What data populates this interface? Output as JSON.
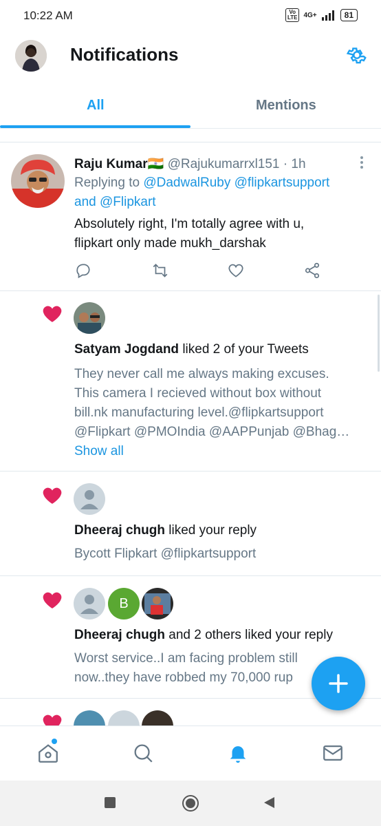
{
  "status_bar": {
    "time": "10:22 AM",
    "network": "4G+",
    "volte": "Vo LTE",
    "battery": "81"
  },
  "header": {
    "title": "Notifications"
  },
  "tabs": [
    {
      "label": "All"
    },
    {
      "label": "Mentions"
    }
  ],
  "reply_tweet": {
    "name": "Raju Kumar",
    "flag": "🇮🇳",
    "handle": "@Rajukumarrxl151",
    "time": "· 1h",
    "replying_prefix": "Replying to",
    "replying_1": "@DadwalRuby",
    "replying_2": "@flipkartsupport",
    "replying_and": "and",
    "replying_3": "@Flipkart",
    "text_1": "Absolutely right, I'm totally agree with u,",
    "text_2": "flipkart only made mukh_darshak"
  },
  "notifications": [
    {
      "name": "Satyam Jogdand",
      "action": "liked 2 of your Tweets",
      "lines": [
        "They never call me always making excuses.",
        "This camera I recieved without box without",
        "bill.nk manufacturing level.@flipkartsupport",
        "@Flipkart @PMOIndia @AAPPunjab @Bhag…"
      ],
      "show_all": "Show all"
    },
    {
      "name": "Dheeraj chugh",
      "action": "liked your reply",
      "lines": [
        "Bycott Flipkart @flipkartsupport"
      ]
    },
    {
      "name": "Dheeraj chugh",
      "action": "and 2 others liked your reply",
      "avatar_letter": "B",
      "lines": [
        "Worst service..I am facing problem still",
        "now..they have robbed my 70,000 rup"
      ]
    }
  ],
  "colors": {
    "accent": "#1da1f2",
    "heart": "#e0245e",
    "text": "#14171a",
    "secondary": "#657786"
  }
}
